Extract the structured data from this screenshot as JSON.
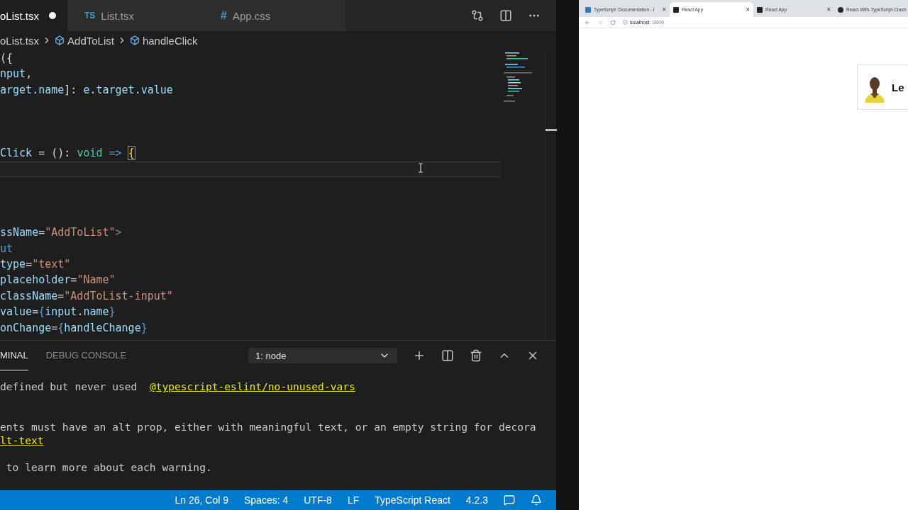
{
  "editor_tabs": [
    {
      "label": "oList.tsx",
      "modified": true,
      "selected": true
    },
    {
      "label": "List.tsx",
      "badge": "TS",
      "modified": false,
      "selected": false
    },
    {
      "label": "App.css",
      "badge": "#",
      "modified": false,
      "selected": false
    }
  ],
  "breadcrumbs": [
    {
      "label": "oList.tsx",
      "kind": "file"
    },
    {
      "label": "AddToList",
      "kind": "symbol"
    },
    {
      "label": "handleClick",
      "kind": "symbol"
    }
  ],
  "code_lines": [
    {
      "current": false,
      "tokens": [
        {
          "kind": "punct",
          "text": "({"
        }
      ]
    },
    {
      "current": false,
      "tokens": [
        {
          "kind": "var",
          "text": "nput"
        },
        {
          "kind": "punct",
          "text": ","
        }
      ]
    },
    {
      "current": false,
      "tokens": [
        {
          "kind": "var",
          "text": "arget"
        },
        {
          "kind": "punct",
          "text": "."
        },
        {
          "kind": "var",
          "text": "name"
        },
        {
          "kind": "punct",
          "text": "]: "
        },
        {
          "kind": "var",
          "text": "e"
        },
        {
          "kind": "punct",
          "text": "."
        },
        {
          "kind": "var",
          "text": "target"
        },
        {
          "kind": "punct",
          "text": "."
        },
        {
          "kind": "var",
          "text": "value"
        }
      ]
    },
    {
      "current": false
    },
    {
      "current": false
    },
    {
      "current": false
    },
    {
      "current": false,
      "tokens": [
        {
          "kind": "var",
          "text": "Click"
        },
        {
          "kind": "punct",
          "text": " = (): "
        },
        {
          "kind": "type",
          "text": "void "
        },
        {
          "kind": "keyword",
          "text": "=> "
        },
        {
          "kind": "bracket",
          "text": "{",
          "matched": true
        }
      ]
    },
    {
      "current": true
    },
    {
      "current": false
    },
    {
      "current": false
    },
    {
      "current": false
    },
    {
      "current": false,
      "tokens": [
        {
          "kind": "var",
          "text": "ssName"
        },
        {
          "kind": "punct",
          "text": "="
        },
        {
          "kind": "string",
          "text": "\"AddToList\""
        },
        {
          "kind": "tag",
          "text": ">"
        }
      ]
    },
    {
      "current": false,
      "tokens": [
        {
          "kind": "keyword",
          "text": "ut"
        }
      ]
    },
    {
      "current": false,
      "tokens": [
        {
          "kind": "var",
          "text": "type"
        },
        {
          "kind": "punct",
          "text": "="
        },
        {
          "kind": "string",
          "text": "\"text\""
        }
      ]
    },
    {
      "current": false,
      "tokens": [
        {
          "kind": "var",
          "text": "placeholder"
        },
        {
          "kind": "punct",
          "text": "="
        },
        {
          "kind": "string",
          "text": "\"Name\""
        }
      ]
    },
    {
      "current": false,
      "tokens": [
        {
          "kind": "var",
          "text": "className"
        },
        {
          "kind": "punct",
          "text": "="
        },
        {
          "kind": "string",
          "text": "\"AddToList-input\""
        }
      ]
    },
    {
      "current": false,
      "tokens": [
        {
          "kind": "var",
          "text": "value"
        },
        {
          "kind": "punct",
          "text": "="
        },
        {
          "kind": "keyword",
          "text": "{"
        },
        {
          "kind": "var",
          "text": "input"
        },
        {
          "kind": "punct",
          "text": "."
        },
        {
          "kind": "var",
          "text": "name"
        },
        {
          "kind": "keyword",
          "text": "}"
        }
      ]
    },
    {
      "current": false,
      "tokens": [
        {
          "kind": "var",
          "text": "onChange"
        },
        {
          "kind": "punct",
          "text": "="
        },
        {
          "kind": "keyword",
          "text": "{"
        },
        {
          "kind": "var",
          "text": "handleChange"
        },
        {
          "kind": "keyword",
          "text": "}"
        }
      ]
    }
  ],
  "panel_tabs": [
    {
      "label": "MINAL",
      "selected": true
    },
    {
      "label": "DEBUG CONSOLE",
      "selected": false
    }
  ],
  "terminal_select": {
    "value": "1: node"
  },
  "terminal_blocks": [
    {
      "lines": [
        {
          "segments": [
            {
              "kind": "text",
              "text": "defined but never used  "
            },
            {
              "kind": "link",
              "text": "@typescript-eslint/no-unused-vars"
            }
          ]
        }
      ]
    },
    {
      "lines": [
        {
          "segments": [
            {
              "kind": "text",
              "text": "ents must have an alt prop, either with meaningful text, or an empty string for decora"
            }
          ]
        },
        {
          "segments": [
            {
              "kind": "link",
              "text": "lt-text"
            }
          ]
        }
      ]
    },
    {
      "lines": [
        {
          "segments": [
            {
              "kind": "text",
              "text": " to learn more about each warning."
            }
          ]
        }
      ]
    }
  ],
  "status_bar": [
    "Ln 26, Col 9",
    "Spaces: 4",
    "UTF-8",
    "LF",
    "TypeScript React",
    "4.2.3"
  ],
  "browser": {
    "tabs": [
      {
        "title": "TypeScript: Documentation - I",
        "kind": "ts",
        "close": "×",
        "selected": false
      },
      {
        "title": "React App",
        "kind": "react",
        "close": "×",
        "selected": true
      },
      {
        "title": "React App",
        "kind": "react",
        "close": "×",
        "selected": false
      },
      {
        "title": "React-With-TypeScript-Crash",
        "kind": "github",
        "selected": false
      }
    ],
    "address": {
      "host": "localhost",
      "port": ":3000"
    },
    "card": {
      "name": "Le",
      "kind": "picture"
    }
  }
}
